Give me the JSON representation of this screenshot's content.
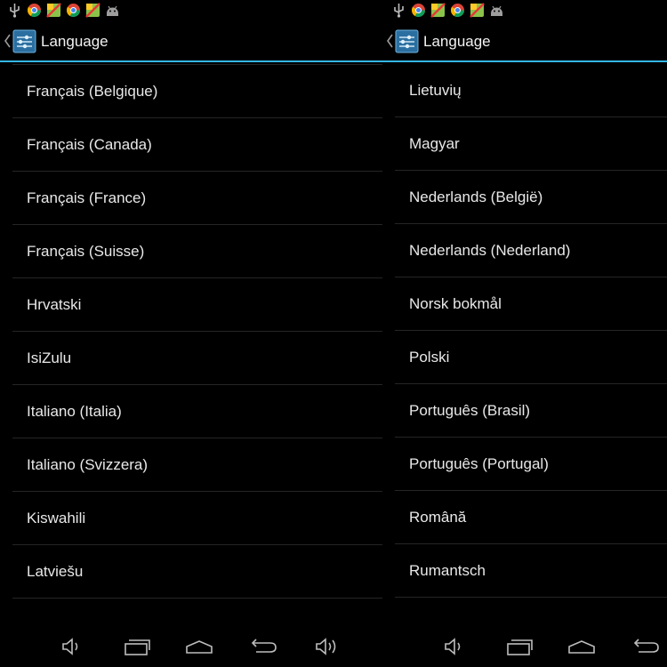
{
  "screens": [
    {
      "actionbar": {
        "title": "Language"
      },
      "items": [
        {
          "label": "Français (Belgique)"
        },
        {
          "label": "Français (Canada)"
        },
        {
          "label": "Français (France)"
        },
        {
          "label": "Français (Suisse)"
        },
        {
          "label": "Hrvatski"
        },
        {
          "label": "IsiZulu"
        },
        {
          "label": "Italiano (Italia)"
        },
        {
          "label": "Italiano (Svizzera)"
        },
        {
          "label": "Kiswahili"
        },
        {
          "label": "Latviešu"
        }
      ]
    },
    {
      "actionbar": {
        "title": "Language"
      },
      "items": [
        {
          "label": "Lietuvių"
        },
        {
          "label": "Magyar"
        },
        {
          "label": "Nederlands (België)"
        },
        {
          "label": "Nederlands (Nederland)"
        },
        {
          "label": "Norsk bokmål"
        },
        {
          "label": "Polski"
        },
        {
          "label": "Português (Brasil)"
        },
        {
          "label": "Português (Portugal)"
        },
        {
          "label": "Română"
        },
        {
          "label": "Rumantsch"
        }
      ]
    }
  ],
  "status_icons": [
    "usb-icon",
    "chrome-icon",
    "maps-icon",
    "chrome-icon",
    "maps-icon",
    "android-icon"
  ],
  "colors": {
    "accent": "#33b5e5",
    "background": "#000000",
    "divider": "#252525",
    "text": "#e8e8e8"
  }
}
